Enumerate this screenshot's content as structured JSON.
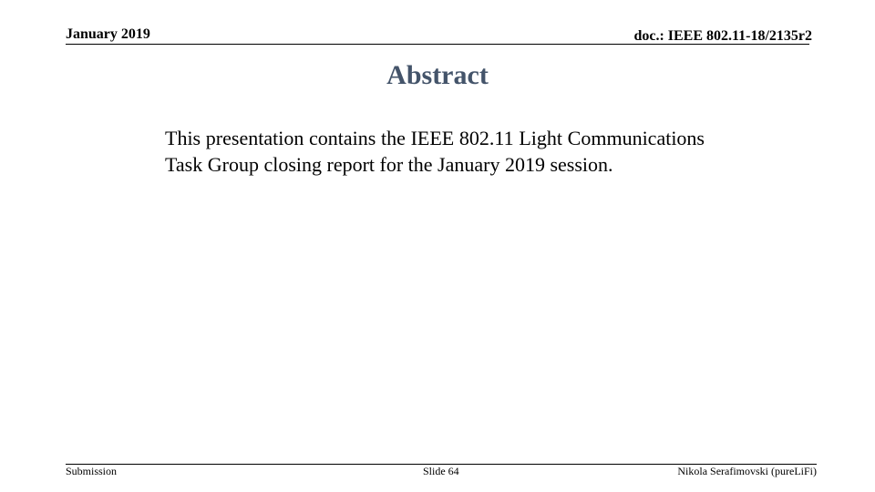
{
  "header": {
    "date": "January 2019",
    "doc_id": "doc.: IEEE 802.11-18/2135r2"
  },
  "slide": {
    "title": "Abstract",
    "body": "This presentation contains the IEEE 802.11 Light Communications Task Group closing report for the January 2019 session."
  },
  "footer": {
    "left": "Submission",
    "center": "Slide 64",
    "right": "Nikola Serafimovski (pureLiFi)"
  },
  "colors": {
    "title": "#44546a",
    "text": "#000000"
  }
}
